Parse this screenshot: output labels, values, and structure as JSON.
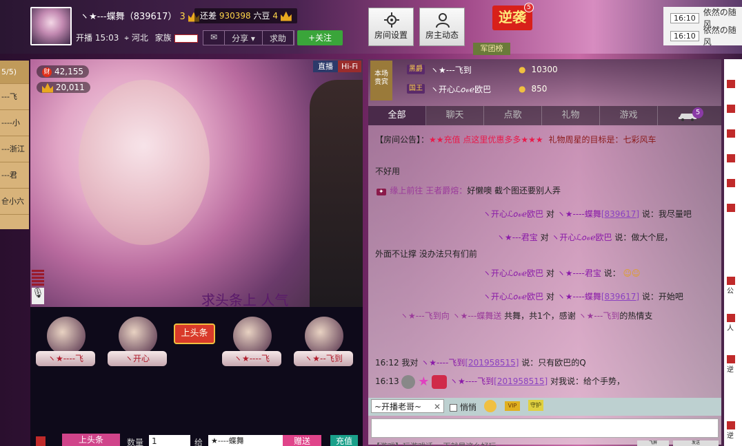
{
  "header": {
    "host_name": "ヽ★---蝶舞（839617）",
    "host_level": "3",
    "gap_label": "还差",
    "gap_value": "930398",
    "gap_unit": "六豆",
    "next_level": "4",
    "start_label": "开播 15:03",
    "location": "河北",
    "family_label": "家族",
    "share_label": "分享",
    "ask_label": "求助",
    "follow_label": "+关注",
    "room_settings": "房间设置",
    "owner_feed": "房主动态",
    "nixi_label": "逆袭",
    "nixi_count": "5",
    "junbang_label": "军团榜"
  },
  "ticker": [
    {
      "time": "16:10",
      "text": "依然の随风"
    },
    {
      "time": "16:10",
      "text": "依然の随风"
    }
  ],
  "left_list": {
    "top": "5/5)",
    "items": [
      "---飞",
      "----小",
      "---浙江",
      "---君",
      "仺小六"
    ]
  },
  "video": {
    "fans_count": "42,155",
    "wealth_count": "20,011",
    "wealth_icon_text": "财",
    "live_label": "直播",
    "hifi_label": "Hi-Fi",
    "caption": "求头条上 人气"
  },
  "ranking": {
    "items": [
      {
        "name": "ヽ★----飞"
      },
      {
        "name": "ヽ开心"
      },
      {
        "name": "ヽ★----飞"
      },
      {
        "name": "ヽ★--飞到"
      }
    ],
    "toutiao": "上头条"
  },
  "giftbar": {
    "gift_button": "上头条",
    "qty_label": "数量",
    "qty_value": "1",
    "to_label": "给",
    "to_value": "★----蝶舞",
    "give_label": "赠送",
    "recharge_label": "充值"
  },
  "vip": {
    "box_label": "本场\n贵宾",
    "rows": [
      {
        "tag": "黑爵",
        "name": "ヽ★---飞到",
        "coins": "10300"
      },
      {
        "tag": "国王",
        "name": "ヽ开心ℒ𝑜𝓋ℯ欧巴",
        "coins": "850"
      }
    ]
  },
  "tabs": [
    "全部",
    "聊天",
    "点歌",
    "礼物",
    "游戏"
  ],
  "car_badge": "5",
  "messages": {
    "announce_prefix": "【房间公告】：",
    "announce_text": "★★充值 点这里优惠多多★★★",
    "goal_text": "礼物周星的目标是：七彩风车",
    "m0": "不好用",
    "m1_pre": "缘上前往 王者爵熔：",
    "m1_text": "好懒噢 截个图还要别人弄",
    "m2_nick": "ヽ开心ℒ𝑜𝓋ℯ欧巴",
    "m2_to": "对",
    "m2_target": "ヽ★----蝶舞",
    "m2_id": "[839617]",
    "m2_text": "说：我尽量吧",
    "m3_nick": "ヽ★---君宝",
    "m3_to": "对",
    "m3_target": "ヽ开心ℒ𝑜𝓋ℯ欧巴",
    "m3_text": "说：做大个屁，",
    "m3b": "外面不让撑 没办法只有们前",
    "m4_nick": "ヽ开心ℒ𝑜𝓋ℯ欧巴",
    "m4_to": "对",
    "m4_target": "ヽ★----君宝",
    "m4_text": "说：",
    "m5_nick": "ヽ开心ℒ𝑜𝓋ℯ欧巴",
    "m5_to": "对",
    "m5_target": "ヽ★----蝶舞",
    "m5_id": "[839617]",
    "m5_text": "说：开始吧",
    "m6_a": "ヽ★---飞到向",
    "m6_b": "ヽ★---蝶舞送",
    "m6_c": "共舞，共1个，感谢",
    "m6_d": "ヽ★---飞到",
    "m6_e": "的热情支",
    "m7_time": "16:12",
    "m7_pre": "我对",
    "m7_nick": "ヽ★----飞到",
    "m7_id": "[201958515]",
    "m7_text": "说：只有欧巴的Q",
    "m8_time": "16:13",
    "m8_nick": "ヽ★----飞到",
    "m8_id": "[201958515]",
    "m8_text": "对我说：给个手势，"
  },
  "input": {
    "target": "~开播老哥~",
    "private_label": "悄悄",
    "vip_label": "VIP",
    "guard_label": "守护",
    "hint": "【游戏】玩游戏话 一下就是这么好玩",
    "fly_label": "飞屏",
    "send_label": "发送"
  },
  "rightstrip": {
    "items": [
      "",
      "",
      "",
      "",
      "",
      "",
      "公",
      "",
      "人",
      "",
      "逆",
      "",
      "",
      "",
      "逆"
    ]
  },
  "colors": {
    "accent": "#8a1aa8",
    "follow": "#3aa53a",
    "nixi": "#d8201a"
  }
}
